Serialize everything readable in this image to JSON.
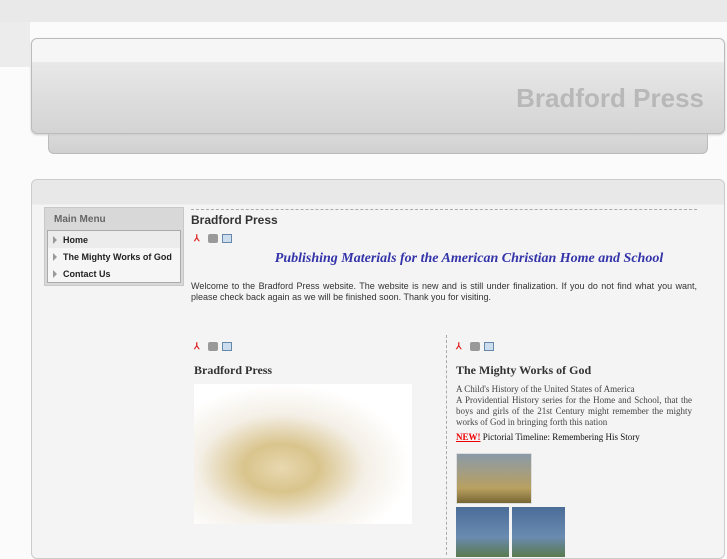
{
  "header": {
    "site_title": "Bradford Press"
  },
  "menu": {
    "title": "Main Menu",
    "items": [
      {
        "label": "Home"
      },
      {
        "label": "The Mighty Works of God"
      },
      {
        "label": "Contact Us"
      }
    ]
  },
  "content": {
    "title": "Bradford Press",
    "tagline": "Publishing Materials for the American Christian Home and School",
    "welcome": "Welcome to the Bradford Press website. The website is new and is still under finalization. If you do not find what you want, please check back again as we will be finished soon. Thank you for visiting."
  },
  "left_article": {
    "title": "Bradford Press"
  },
  "right_article": {
    "title": "The Mighty Works of God",
    "line1": "A Child's History of the United States of America",
    "line2": "A Providential History series for the Home and School, that the boys and girls of the 21st Century might remember the mighty works of God in bringing forth this nation",
    "new_label": "NEW!",
    "new_text": " Pictorial Timeline: Remembering His Story"
  }
}
